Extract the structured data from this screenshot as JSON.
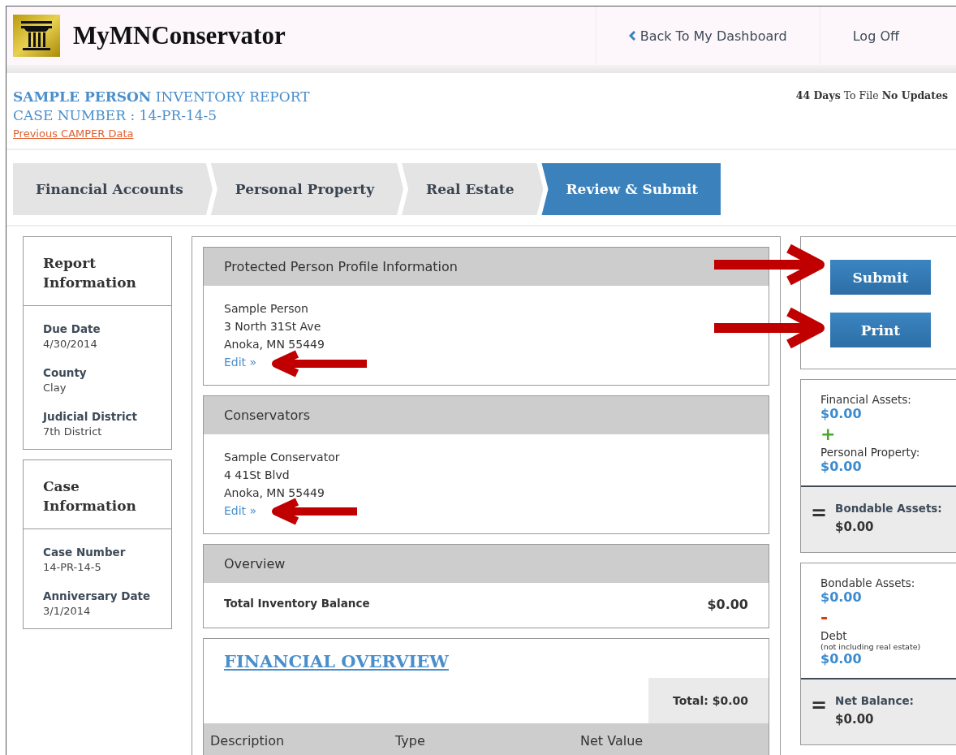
{
  "header": {
    "title": "MyMNConservator",
    "nav": [
      {
        "label": "Back To My Dashboard",
        "kind": "back"
      },
      {
        "label": "Log Off",
        "kind": "plain"
      }
    ]
  },
  "report": {
    "person": "SAMPLE PERSON",
    "title": "INVENTORY REPORT",
    "case_number": "CASE NUMBER : 14-PR-14-5",
    "previous_link": "Previous CAMPER Data",
    "status": "**44 Days** To File **No Updates**"
  },
  "tabs": [
    {
      "label": "Financial Accounts",
      "selected": false
    },
    {
      "label": "Personal Property",
      "selected": false
    },
    {
      "label": "Real Estate",
      "selected": false
    },
    {
      "label": "Review & Submit",
      "selected": true
    }
  ],
  "sidebar": [
    {
      "title": "Report Information",
      "fields": [
        {
          "label": "Due Date",
          "value": "4/30/2014"
        },
        {
          "label": "County",
          "value": "Clay"
        },
        {
          "label": "Judicial District",
          "value": "7th District"
        }
      ]
    },
    {
      "title": "Case Information",
      "fields": [
        {
          "label": "Case Number",
          "value": "14-PR-14-5"
        },
        {
          "label": "Anniversary Date",
          "value": "3/1/2014"
        }
      ]
    }
  ],
  "profile": {
    "title": "Protected Person Profile Information",
    "lines": [
      "Sample Person",
      "3 North 31St Ave",
      "Anoka, MN 55449"
    ],
    "edit": "Edit »"
  },
  "conservators": {
    "title": "Conservators",
    "lines": [
      "Sample Conservator",
      "4 41St Blvd",
      "Anoka, MN 55449"
    ],
    "edit": "Edit »"
  },
  "overview": {
    "title": "Overview",
    "label": "Total Inventory Balance",
    "value": "$0.00"
  },
  "financial_overview": {
    "title": "FINANCIAL OVERVIEW",
    "total": "Total: $0.00",
    "columns": [
      "Description",
      "Type",
      "Net Value"
    ]
  },
  "actions": [
    "Submit",
    "Print"
  ],
  "summary": [
    {
      "first": {
        "label": "Financial Assets:",
        "value": "$0.00"
      },
      "operator": {
        "symbol": "+",
        "kind": "plus"
      },
      "second": {
        "label": "Personal Property:",
        "value": "$0.00"
      },
      "result": {
        "symbol": "=",
        "label": "Bondable Assets:",
        "value": "$0.00"
      }
    },
    {
      "first": {
        "label": "Bondable Assets:",
        "value": "$0.00"
      },
      "operator": {
        "symbol": "-",
        "kind": "minus"
      },
      "second": {
        "label": "Debt",
        "note": "(not including real estate)",
        "value": "$0.00"
      },
      "result": {
        "symbol": "=",
        "label": "Net Balance:",
        "value": "$0.00"
      }
    }
  ]
}
